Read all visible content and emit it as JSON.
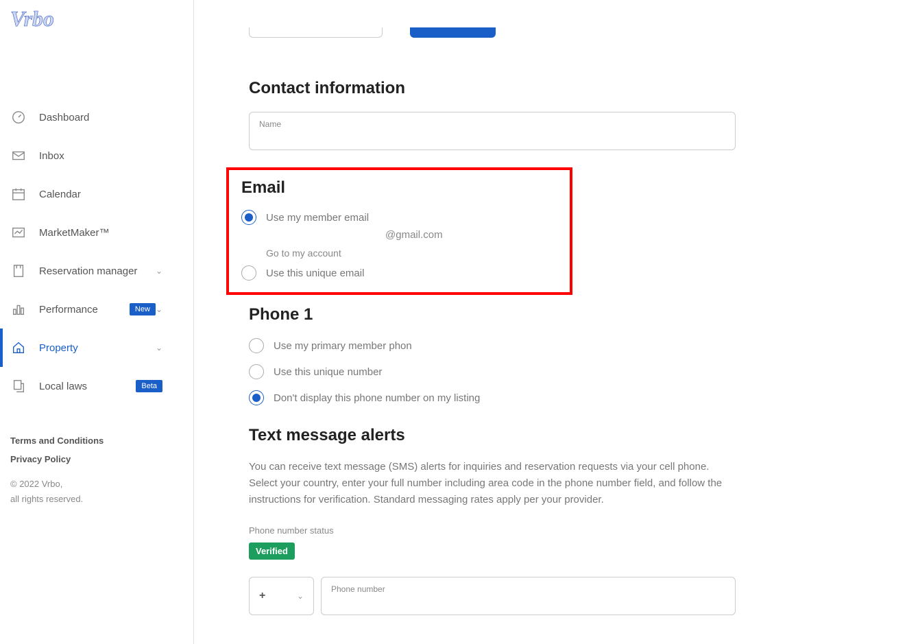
{
  "logo_text": "Vrbo",
  "sidebar": {
    "items": [
      {
        "label": "Dashboard",
        "expandable": false
      },
      {
        "label": "Inbox",
        "expandable": false
      },
      {
        "label": "Calendar",
        "expandable": false
      },
      {
        "label": "MarketMaker™",
        "expandable": false
      },
      {
        "label": "Reservation manager",
        "expandable": true
      },
      {
        "label": "Performance",
        "badge": "New",
        "expandable": true
      },
      {
        "label": "Property",
        "expandable": true,
        "active": true
      },
      {
        "label": "Local laws",
        "badge": "Beta",
        "expandable": false
      }
    ],
    "footer": {
      "terms": "Terms and Conditions",
      "privacy": "Privacy Policy",
      "copyright_line1": "© 2022 Vrbo,",
      "copyright_line2": "all rights reserved."
    }
  },
  "contact": {
    "title": "Contact information",
    "name_label": "Name"
  },
  "email": {
    "title": "Email",
    "option_member": "Use my member email",
    "member_suffix": "@gmail.com",
    "account_link": "Go to my account",
    "option_unique": "Use this unique email"
  },
  "phone": {
    "title": "Phone 1",
    "option_primary": "Use my primary member phon",
    "option_unique": "Use this unique number",
    "option_hide": "Don't display this phone number on my listing"
  },
  "sms": {
    "title": "Text message alerts",
    "description": "You can receive text message (SMS) alerts for inquiries and reservation requests via your cell phone. Select your country, enter your full number including area code in the phone number field, and follow the instructions for verification. Standard messaging rates apply per your provider.",
    "status_label": "Phone number status",
    "verified": "Verified",
    "country_prefix": "+",
    "phone_label": "Phone number"
  }
}
